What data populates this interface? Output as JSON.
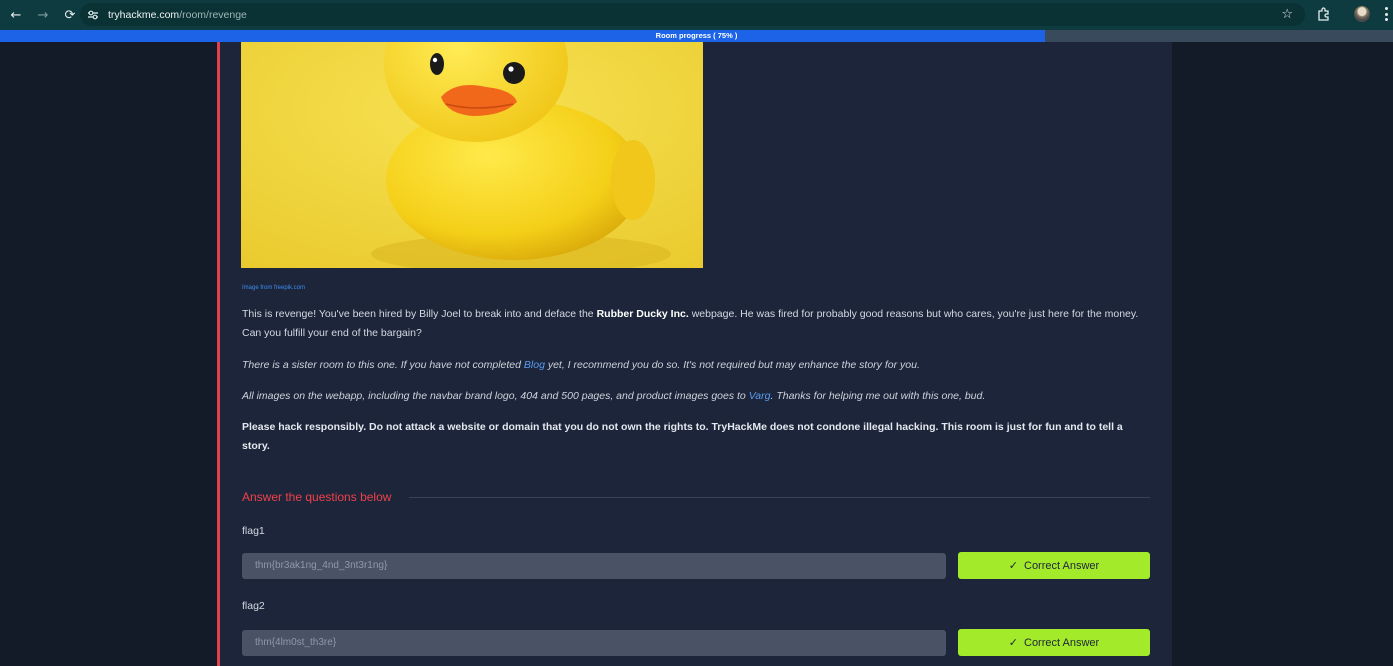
{
  "browser": {
    "url_host": "tryhackme.com",
    "url_path": "/room/revenge"
  },
  "progress": {
    "label": "Room progress ( 75% )",
    "percent": 75
  },
  "content": {
    "image_credit": "Image from freepik.com",
    "p1_before": "This is revenge! You've been hired by Billy Joel to break into and deface the ",
    "p1_bold": "Rubber Ducky Inc.",
    "p1_after": " webpage. He was fired for probably good reasons but who cares, you're just here for the money. Can you fulfill your end of the bargain?",
    "p2_before": "There is a sister room to this one. If you have not completed ",
    "p2_link": "Blog",
    "p2_after": " yet, I recommend you do so. It's not required but may enhance the story for you.",
    "p3_before": "All images on the webapp, including the navbar brand logo, 404 and 500 pages, and product images goes to ",
    "p3_link": "Varg",
    "p3_after": ". Thanks for helping me out with this one, bud.",
    "p4": "Please hack responsibly. Do not attack a website or domain that you do not own the rights to. TryHackMe does not condone illegal hacking. This room is just for fun and to tell a story."
  },
  "questions": {
    "heading": "Answer the questions below",
    "items": [
      {
        "label": "flag1",
        "answer": "thm{br3ak1ng_4nd_3nt3r1ng}",
        "button": "Correct Answer"
      },
      {
        "label": "flag2",
        "answer": "thm{4lm0st_th3re}",
        "button": "Correct Answer"
      }
    ]
  },
  "colors": {
    "accent_red": "#e0424b",
    "progress_blue": "#1c63e8",
    "correct_green": "#a3ea2a"
  }
}
